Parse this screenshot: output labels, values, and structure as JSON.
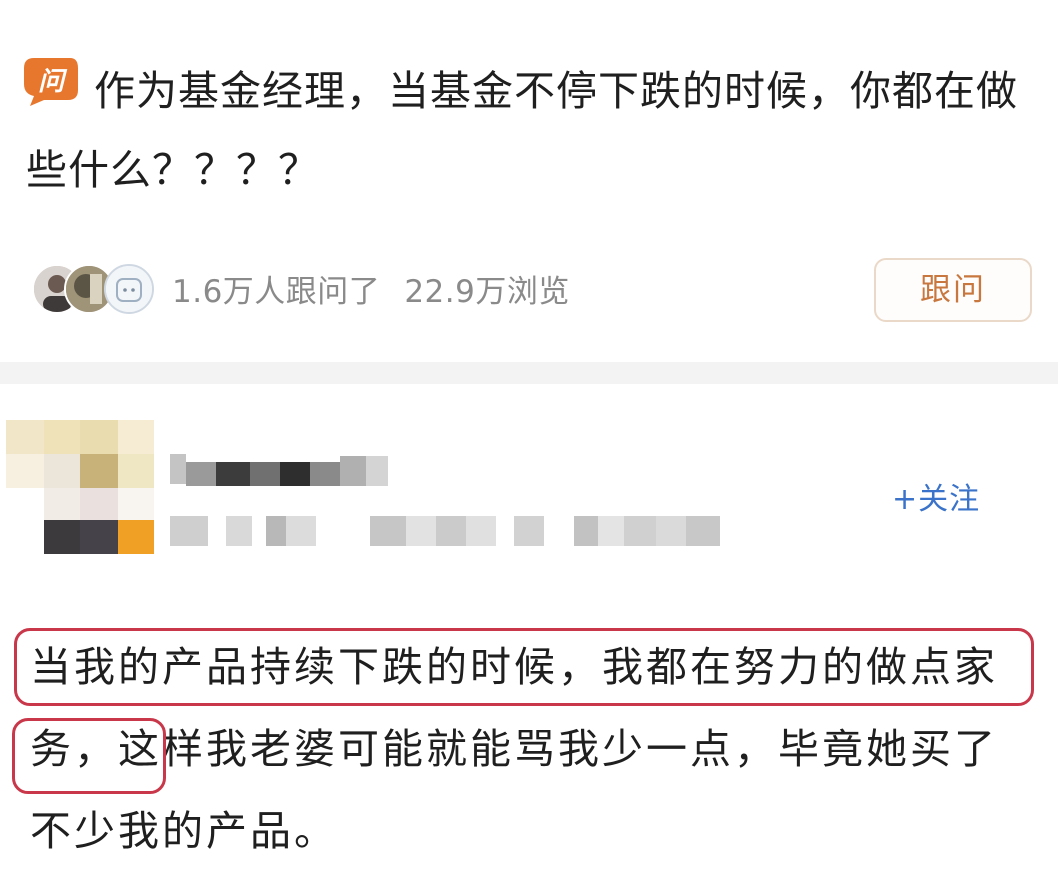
{
  "question": {
    "badge_label": "问",
    "title": "作为基金经理，当基金不停下跌的时候，你都在做些什么？？？？",
    "follow_count": "1.6万人跟问了",
    "view_count": "22.9万浏览",
    "follow_question_label": "跟问"
  },
  "answer": {
    "follow_user_label": "+关注",
    "body": "当我的产品持续下跌的时候，我都在努力的做点家务，这样我老婆可能就能骂我少一点，毕竟她买了不少我的产品。"
  },
  "colors": {
    "accent_orange": "#e8772e",
    "follow_question_text": "#c8783f",
    "follow_user_text": "#3a73c9",
    "highlight_red": "#c9384a"
  }
}
